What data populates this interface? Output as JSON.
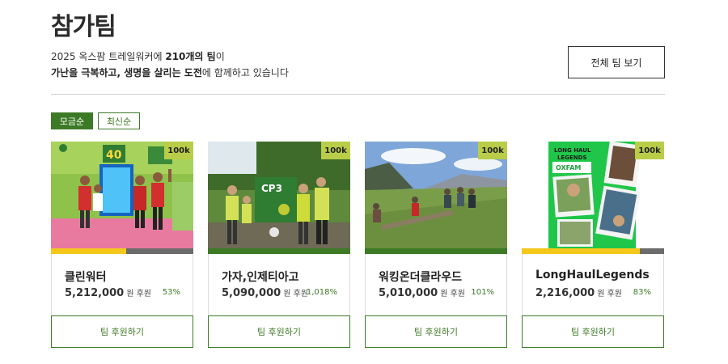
{
  "header": {
    "title": "참가팀",
    "intro_line1_pre": "2025 옥스팜 트레일워커에 ",
    "intro_line1_bold": "210개의 팀",
    "intro_line1_post": "이",
    "intro_line2_bold": "가난을 극복하고, 생명을 살리는 도전",
    "intro_line2_post": "에 함께하고 있습니다",
    "view_all_label": "전체 팀 보기"
  },
  "sort": {
    "active_label": "모금순",
    "inactive_label": "최신순"
  },
  "colors": {
    "accent_green": "#3d7a25",
    "badge_lime": "#b9cd48",
    "progress_yellow": "#f4c81a",
    "progress_green": "#3d7a25",
    "progress_track": "#6b6b6b"
  },
  "teams": [
    {
      "badge": "100k",
      "name": "클린워터",
      "amount": "5,212,000",
      "unit": "원 후원",
      "percent": "53%",
      "progress": 0.53,
      "progress_color": "#f4c81a",
      "support_label": "팀 후원하기",
      "image": "event-banner-photo"
    },
    {
      "badge": "100k",
      "name": "가자,인제티아고",
      "amount": "5,090,000",
      "unit": "원 후원",
      "percent": "1,018%",
      "progress": 1.0,
      "progress_color": "#3d7a25",
      "support_label": "팀 후원하기",
      "image": "checkpoint-cp3-photo"
    },
    {
      "badge": "100k",
      "name": "워킹온더클라우드",
      "amount": "5,010,000",
      "unit": "원 후원",
      "percent": "101%",
      "progress": 1.0,
      "progress_color": "#3d7a25",
      "support_label": "팀 후원하기",
      "image": "mountain-hikers-photo"
    },
    {
      "badge": "100k",
      "name": "LongHaulLegends",
      "amount": "2,216,000",
      "unit": "원 후원",
      "percent": "83%",
      "progress": 0.83,
      "progress_color": "#f4c81a",
      "support_label": "팀 후원하기",
      "image": "team-poster-collage"
    }
  ]
}
